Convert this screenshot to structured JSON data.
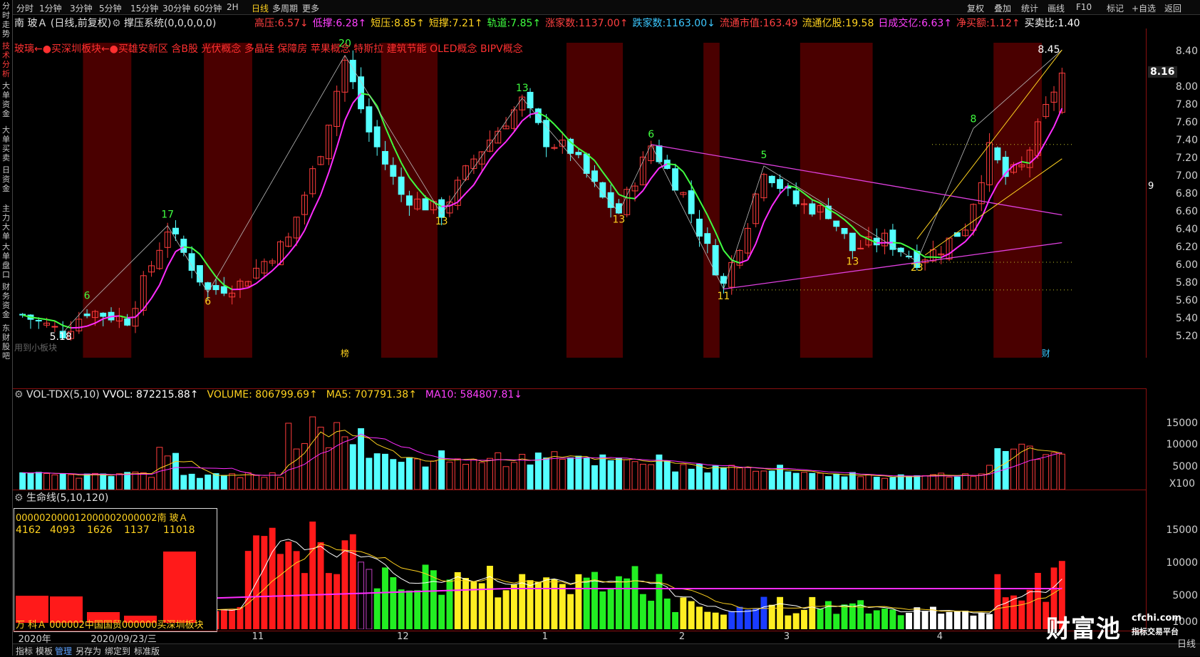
{
  "sidebar": {
    "items": [
      {
        "label": "分时走势",
        "active": false
      },
      {
        "label": "技术分析",
        "active": true
      },
      {
        "label": "大单资金",
        "active": false
      },
      {
        "label": "大单买卖",
        "active": false
      },
      {
        "label": "日资金",
        "active": false
      },
      {
        "label": "主力大单",
        "active": false
      },
      {
        "label": "大单盘口",
        "active": false
      },
      {
        "label": "财务资金",
        "active": false
      },
      {
        "label": "东财股吧",
        "active": false
      }
    ]
  },
  "toolbar": {
    "periods": [
      "分时",
      "1分钟",
      "3分钟",
      "5分钟",
      "15分钟",
      "30分钟",
      "60分钟",
      "2H",
      "日线",
      "多周期",
      "更多"
    ],
    "active_period": "日线",
    "right_items": [
      "复权",
      "叠加",
      "统计",
      "画线",
      "F10",
      "标记",
      "+自选",
      "返回"
    ]
  },
  "info": {
    "stock": "南 玻Ａ (日线,前复权)",
    "indicator": "撑压系统(0,0,0,0,0)",
    "fields": [
      {
        "label": "高压:",
        "value": "6.57",
        "arrow": "↓",
        "color": "#ff4040"
      },
      {
        "label": "低撑:",
        "value": "6.28",
        "arrow": "↑",
        "color": "#ff40ff"
      },
      {
        "label": "短压:",
        "value": "8.85",
        "arrow": "↑",
        "color": "#ffd21f"
      },
      {
        "label": "短撑:",
        "value": "7.21",
        "arrow": "↑",
        "color": "#ffd21f"
      },
      {
        "label": "轨道:",
        "value": "7.85",
        "arrow": "↑",
        "color": "#40ff40"
      },
      {
        "label": "涨家数:",
        "value": "1137.00",
        "arrow": "↑",
        "color": "#ff4040"
      },
      {
        "label": "跌家数:",
        "value": "1163.00",
        "arrow": "↓",
        "color": "#3cc8ff"
      },
      {
        "label": "流通市值:",
        "value": "163.49",
        "arrow": "",
        "color": "#ff4040"
      },
      {
        "label": "流通亿股:",
        "value": "19.58",
        "arrow": "",
        "color": "#ffd21f"
      },
      {
        "label": "日成交亿:",
        "value": "6.63",
        "arrow": "↑",
        "color": "#ff40ff"
      },
      {
        "label": "净买额:",
        "value": "1.12",
        "arrow": "↑",
        "color": "#ff4040"
      },
      {
        "label": "买卖比:",
        "value": "1.40",
        "arrow": "",
        "color": "#ffffff"
      }
    ],
    "concepts": "玻璃←●买深圳板块←●买雄安新区 含B股 光伏概念 多晶硅 保障房 苹果概念 特斯拉 建筑节能 OLED概念 BIPV概念",
    "watermark_small": "用到小板块"
  },
  "chart_data": [
    {
      "type": "candlestick",
      "title": "",
      "ylim": [
        5.05,
        8.5
      ],
      "yticks": [
        "8.40",
        "8.00",
        "7.80",
        "7.60",
        "7.40",
        "7.20",
        "7.00",
        "6.80",
        "6.60",
        "6.40",
        "6.20",
        "6.00",
        "5.80",
        "5.60",
        "5.40",
        "5.20"
      ],
      "ytick_values": [
        8.4,
        8.0,
        7.8,
        7.6,
        7.4,
        7.2,
        7.0,
        6.8,
        6.6,
        6.4,
        6.2,
        6.0,
        5.8,
        5.6,
        5.4,
        5.2
      ],
      "current_price": "8.16",
      "label_9": "9",
      "high_label": "8.45",
      "low_label": "5.18",
      "markers_bottom": [
        "榜",
        "财"
      ],
      "count_labels": [
        {
          "text": "6",
          "i": 8,
          "v": 5.58,
          "color": "#40ff40"
        },
        {
          "text": "17",
          "i": 18,
          "v": 6.49,
          "color": "#40ff40"
        },
        {
          "text": "6",
          "i": 23,
          "v": 5.66,
          "color": "#ffd21f"
        },
        {
          "text": "20",
          "i": 40,
          "v": 8.41,
          "color": "#40ff40"
        },
        {
          "text": "13",
          "i": 52,
          "v": 6.56,
          "color": "#ffd21f"
        },
        {
          "text": "13",
          "i": 62,
          "v": 7.91,
          "color": "#40ff40"
        },
        {
          "text": "13",
          "i": 74,
          "v": 6.58,
          "color": "#ffd21f"
        },
        {
          "text": "6",
          "i": 78,
          "v": 7.39,
          "color": "#40ff40"
        },
        {
          "text": "11",
          "i": 87,
          "v": 5.72,
          "color": "#ffd21f"
        },
        {
          "text": "5",
          "i": 92,
          "v": 7.16,
          "color": "#40ff40"
        },
        {
          "text": "13",
          "i": 103,
          "v": 6.11,
          "color": "#ffd21f"
        },
        {
          "text": "23",
          "i": 111,
          "v": 6.04,
          "color": "#ffd21f"
        },
        {
          "text": "8",
          "i": 118,
          "v": 7.56,
          "color": "#40ff40"
        }
      ]
    },
    {
      "type": "bar",
      "title": "VOL-TDX(5,10)",
      "legend": [
        {
          "label": "VVOL: 872215.88",
          "arrow": "↑",
          "color": "#ffffff"
        },
        {
          "label": "VOLUME: 806799.69",
          "arrow": "↑",
          "color": "#ffd21f"
        },
        {
          "label": "MA5: 707791.38",
          "arrow": "↑",
          "color": "#ffd21f"
        },
        {
          "label": "MA10: 584807.81",
          "arrow": "↓",
          "color": "#ff40ff"
        }
      ],
      "yticks": [
        "15000",
        "10000",
        "5000"
      ],
      "ytick_values": [
        15000,
        10000,
        5000
      ],
      "ylim": [
        0,
        18500
      ],
      "unit": "X100"
    },
    {
      "type": "bar",
      "title": "生命线(5,10,120)",
      "yticks": [
        "15000",
        "10000",
        "5000",
        "1000"
      ],
      "ytick_values": [
        15000,
        10000,
        5000,
        1000
      ],
      "ylim": [
        0,
        18500
      ]
    }
  ],
  "inset": {
    "title": "000002000012000002000002南 玻Ａ",
    "values": [
      "4162",
      "4093",
      "1626",
      "1137",
      "11018"
    ],
    "bar_values": [
      4162,
      4093,
      1626,
      1137,
      11018
    ],
    "footer": "万 科Ａ 000002中国国贸000000买深圳板块"
  },
  "x_axis": {
    "labels": [
      {
        "text": "2020年",
        "i": 0
      },
      {
        "text": "2020/09/23/三",
        "i": 9
      },
      {
        "text": "11",
        "i": 29
      },
      {
        "text": "12",
        "i": 47
      },
      {
        "text": "1",
        "i": 65
      },
      {
        "text": "2",
        "i": 82
      },
      {
        "text": "3",
        "i": 95
      },
      {
        "text": "4",
        "i": 114
      }
    ]
  },
  "bottom_tabs": [
    "指标",
    "模板",
    "管理",
    "另存为",
    "绑定到",
    "标准版"
  ],
  "bottom_active": "管理",
  "right_label": "日线",
  "watermark": {
    "main": "财富池",
    "site": "cfchi.com",
    "sub": "指标交易平台"
  },
  "colors": {
    "up": "#ff3c3c",
    "down": "#54ffff",
    "ma_green": "#40ff40",
    "ma_magenta": "#ff2cff",
    "bg_shade": "#4a0000"
  }
}
